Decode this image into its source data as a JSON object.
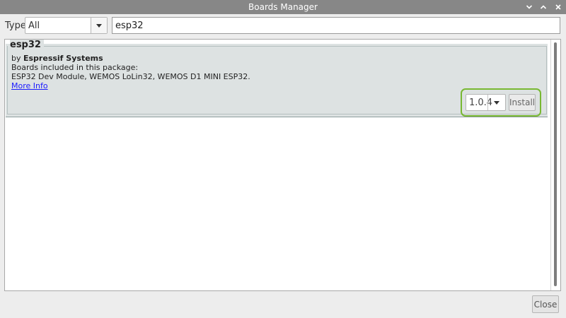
{
  "window": {
    "title": "Boards Manager",
    "controls": {
      "minimize_icon": "chevron-down-icon",
      "maximize_icon": "chevron-up-icon",
      "close_icon": "close-icon"
    }
  },
  "toolbar": {
    "type_label": "Type",
    "type_selected": "All",
    "search_value": "esp32"
  },
  "entries": [
    {
      "name": "esp32",
      "by_prefix": "by ",
      "author": "Espressif Systems",
      "boards_label": "Boards included in this package:",
      "boards": "ESP32 Dev Module, WEMOS LoLin32, WEMOS D1 MINI ESP32.",
      "more_info": "More Info",
      "version_selected": "1.0.4",
      "install_label": "Install"
    }
  ],
  "footer": {
    "close_label": "Close"
  },
  "colors": {
    "titlebar": "#878787",
    "entry_background": "#dde2e2",
    "highlight_ring": "#78b832",
    "link": "#1a1aff"
  }
}
